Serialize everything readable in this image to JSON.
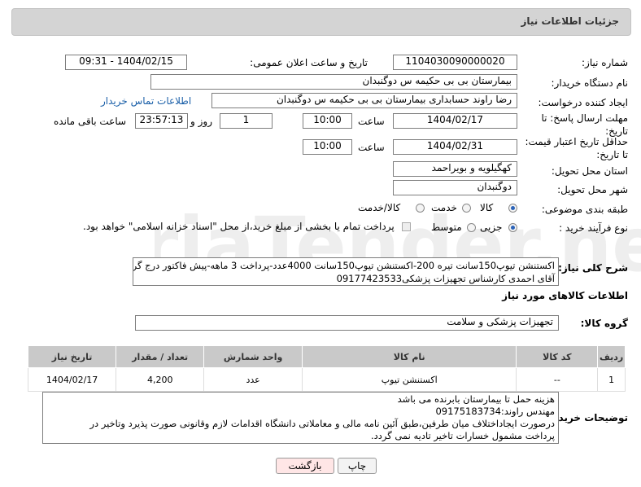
{
  "panel": {
    "title": "جزئیات اطلاعات نیاز"
  },
  "fields": {
    "need_number": {
      "label": "شماره نیاز:",
      "value": "1104030090000020"
    },
    "announce_datetime": {
      "label": "تاریخ و ساعت اعلان عمومی:",
      "value": "1404/02/15 - 09:31"
    },
    "buyer_org": {
      "label": "نام دستگاه خریدار:",
      "value": "بیمارستان بی بی حکیمه س  دوگنبدان"
    },
    "requester": {
      "label": "ایجاد کننده درخواست:",
      "value": "رضا راوند حسابداری بیمارستان بی بی حکیمه س  دوگنبدان",
      "contact_link": "اطلاعات تماس خریدار"
    },
    "reply_deadline": {
      "label": "مهلت ارسال پاسخ: تا تاریخ:",
      "date": "1404/02/17",
      "time_label": "ساعت",
      "time": "10:00",
      "days": "1",
      "days_label": "روز و",
      "remaining": "23:57:13",
      "remaining_label": "ساعت باقی مانده"
    },
    "price_validity": {
      "label": "حداقل تاریخ اعتبار قیمت: تا تاریخ:",
      "date": "1404/02/31",
      "time_label": "ساعت",
      "time": "10:00"
    },
    "delivery_province": {
      "label": "استان محل تحویل:",
      "value": "کهگیلویه و بویراحمد"
    },
    "delivery_city": {
      "label": "شهر محل تحویل:",
      "value": "دوگنبدان"
    },
    "category": {
      "label": "طبقه بندی موضوعی:",
      "options": [
        "کالا",
        "خدمت",
        "کالا/خدمت"
      ],
      "selected": "کالا"
    },
    "purchase_type": {
      "label": "نوع فرآیند خرید :",
      "options": [
        "جزیی",
        "متوسط"
      ],
      "selected": "جزیی",
      "note": "پرداخت تمام یا بخشی از مبلغ خرید،از محل \"اسناد خزانه اسلامی\" خواهد بود."
    }
  },
  "general_description": {
    "label": "شرح کلی نیاز:",
    "line1": "اکستنشن تیوپ150سانت تیره 200-اکستنشن تیوپ150سانت 4000عدد-پرداخت 3 ماهه-پیش فاکتور درج گردد-",
    "line2": "آقای احمدی کارشناس تجهیزات پزشکی09177423533"
  },
  "goods_section": {
    "title": "اطلاعات کالاهای مورد نیاز",
    "group_label": "گروه کالا:",
    "group_value": "تجهیزات پزشکی و سلامت"
  },
  "table": {
    "headers": [
      "ردیف",
      "کد کالا",
      "نام کالا",
      "واحد شمارش",
      "تعداد / مقدار",
      "تاریخ نیاز"
    ],
    "rows": [
      [
        "1",
        "--",
        "اکستنشن تیوپ",
        "عدد",
        "4,200",
        "1404/02/17"
      ]
    ]
  },
  "buyer_notes": {
    "label": "توضیحات خریدار:",
    "lines": [
      "هزینه حمل تا بیمارستان بابرنده می باشد",
      "مهندس راوند:09175183734",
      "درصورت ایجاداختلاف میان طرفین،طبق آئین نامه مالی و معاملاتی دانشگاه اقدامات لازم وقانونی صورت پذیرد وتاخیر در",
      "پرداخت مشمول خسارات تاخیر تادیه نمی گردد."
    ]
  },
  "buttons": {
    "print": "چاپ",
    "back": "بازگشت"
  },
  "watermark": {
    "text": "AriaTender.neT"
  }
}
